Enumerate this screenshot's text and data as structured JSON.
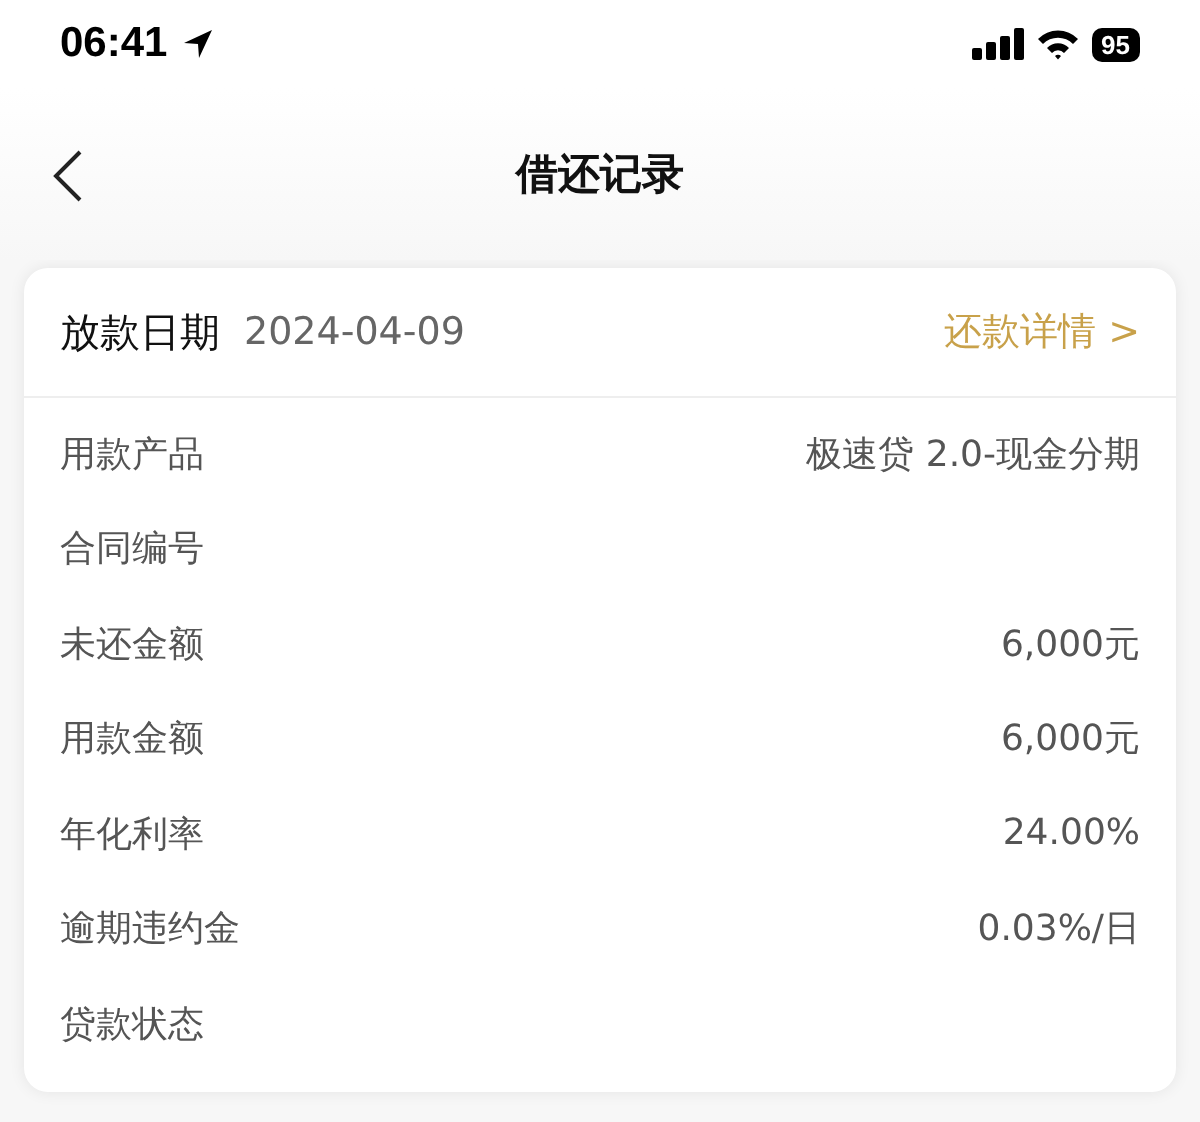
{
  "status_bar": {
    "time": "06:41",
    "battery": "95"
  },
  "nav": {
    "title": "借还记录"
  },
  "card": {
    "header": {
      "label": "放款日期",
      "date": "2024-04-09",
      "link": "还款详情 >"
    },
    "rows": [
      {
        "label": "用款产品",
        "value": "极速贷 2.0-现金分期"
      },
      {
        "label": "合同编号"
      },
      {
        "label": "未还金额",
        "value": "6,000元"
      },
      {
        "label": "用款金额",
        "value": "6,000元"
      },
      {
        "label": "年化利率",
        "value": "24.00%"
      },
      {
        "label": "逾期违约金",
        "value": "0.03%/日"
      },
      {
        "label": "贷款状态"
      }
    ]
  }
}
